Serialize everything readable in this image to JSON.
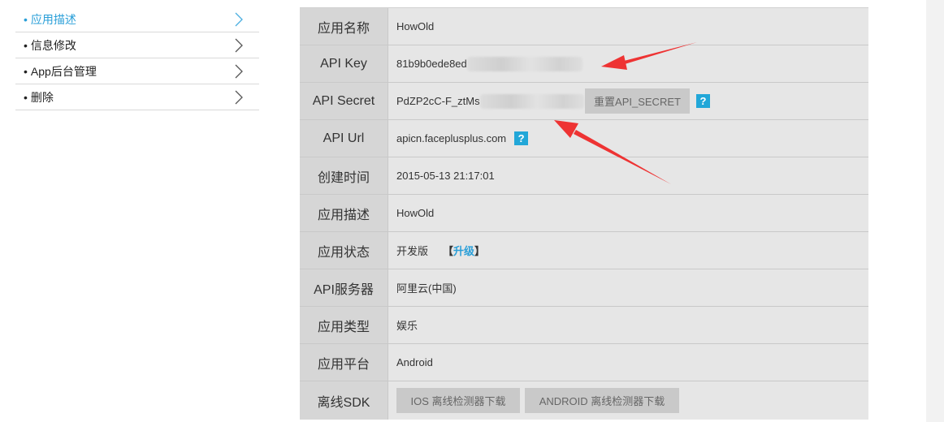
{
  "sidebar": {
    "items": [
      {
        "label": "应用描述",
        "active": true
      },
      {
        "label": "信息修改",
        "active": false
      },
      {
        "label": "App后台管理",
        "active": false
      },
      {
        "label": "删除",
        "active": false
      }
    ],
    "bullet": "•"
  },
  "info": {
    "app_name": {
      "label": "应用名称",
      "value": "HowOld"
    },
    "api_key": {
      "label": "API Key",
      "value": "81b9b0ede8ed"
    },
    "api_secret": {
      "label": "API Secret",
      "value": "PdZP2cC-F_ztMs",
      "reset_button": "重置API_SECRET",
      "help": "?"
    },
    "api_url": {
      "label": "API Url",
      "value": "apicn.faceplusplus.com",
      "help": "?"
    },
    "created": {
      "label": "创建时间",
      "value": "2015-05-13 21:17:01"
    },
    "description": {
      "label": "应用描述",
      "value": "HowOld"
    },
    "status": {
      "label": "应用状态",
      "value": "开发版",
      "bracket_open": "【",
      "upgrade": "升级",
      "bracket_close": "】"
    },
    "server": {
      "label": "API服务器",
      "value": "阿里云(中国)"
    },
    "type": {
      "label": "应用类型",
      "value": "娱乐"
    },
    "platform": {
      "label": "应用平台",
      "value": "Android"
    },
    "sdk": {
      "label": "离线SDK",
      "ios_button": "IOS 离线检测器下载",
      "android_button": "ANDROID 离线检测器下载"
    }
  },
  "colors": {
    "accent": "#2a9fd8",
    "arrow": "#ee3333",
    "help_bg": "#22a7d8"
  }
}
